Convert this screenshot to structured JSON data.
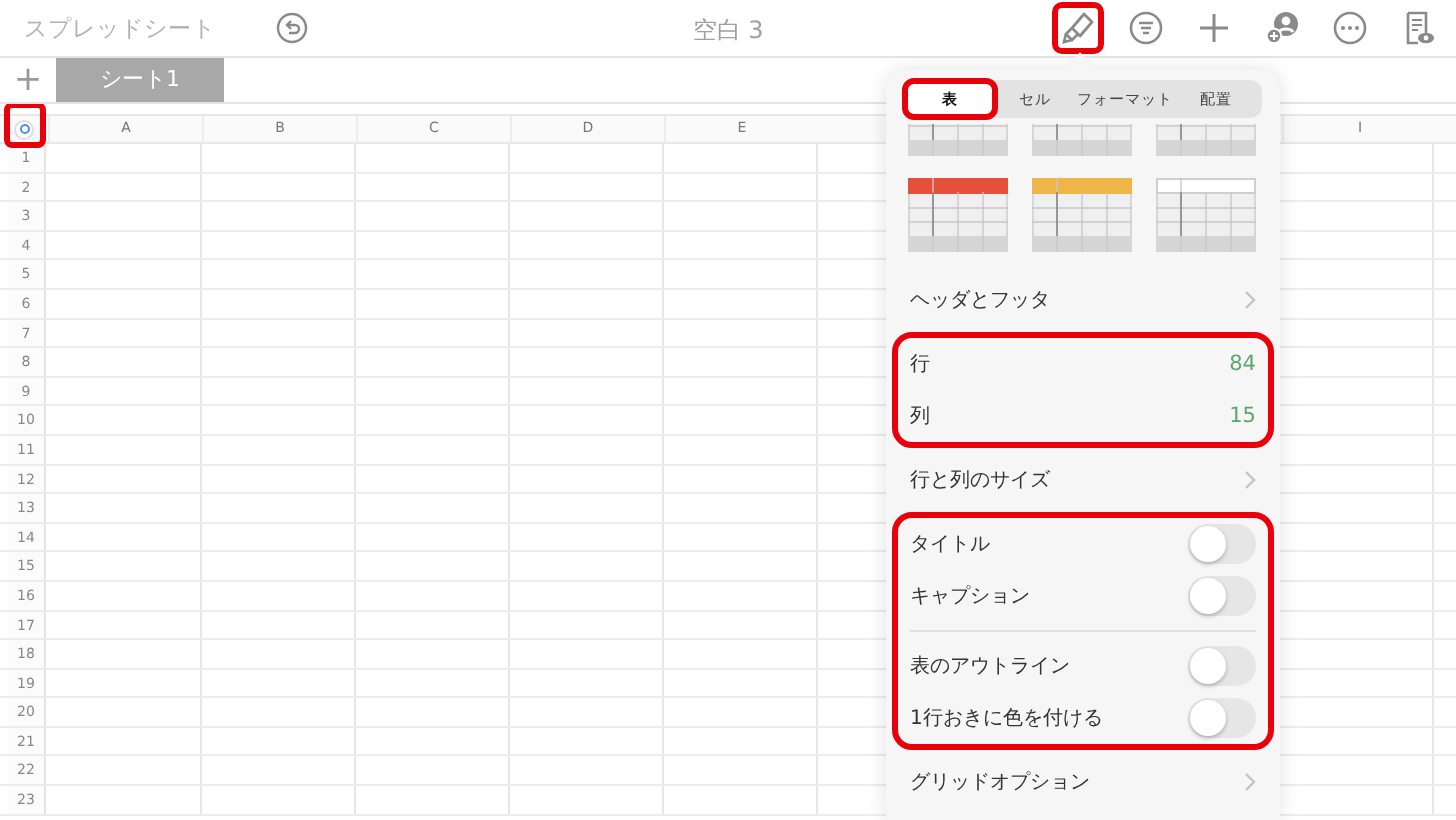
{
  "toolbar": {
    "back_label": "スプレッドシート",
    "title": "空白 3",
    "tools": [
      {
        "kind": "brush",
        "highlighted": true
      },
      {
        "kind": "list",
        "highlighted": false
      },
      {
        "kind": "plus",
        "highlighted": false
      },
      {
        "kind": "person",
        "highlighted": false
      },
      {
        "kind": "more",
        "highlighted": false
      },
      {
        "kind": "doc",
        "highlighted": false
      }
    ]
  },
  "sheet_tabs": {
    "add_label": "+",
    "tabs": [
      {
        "label": "シート1",
        "selected": true
      }
    ]
  },
  "grid": {
    "corner_highlighted": true,
    "columns": [
      {
        "label": "A"
      },
      {
        "label": "B"
      },
      {
        "label": "C"
      },
      {
        "label": "D"
      },
      {
        "label": "E"
      },
      {
        "label": "I"
      }
    ],
    "rows": [
      "1",
      "2",
      "3",
      "4",
      "5",
      "6",
      "7",
      "8",
      "9",
      "10",
      "11",
      "12",
      "13",
      "14",
      "15",
      "16",
      "17",
      "18",
      "19",
      "20",
      "21",
      "22",
      "23"
    ]
  },
  "popover": {
    "tabs": [
      {
        "label": "表",
        "selected": true,
        "highlighted": true
      },
      {
        "label": "セル",
        "selected": false,
        "highlighted": false
      },
      {
        "label": "フォーマット",
        "selected": false,
        "highlighted": false
      },
      {
        "label": "配置",
        "selected": false,
        "highlighted": false
      }
    ],
    "styles": [
      {
        "color": "#c9c9c9",
        "clipped": true
      },
      {
        "color": "#d0d0d0",
        "clipped": true
      },
      {
        "color": "#d0d0d0",
        "clipped": true
      },
      {
        "color": "#e5503b",
        "clipped": false
      },
      {
        "color": "#efb548",
        "clipped": false
      },
      {
        "color": "#ffffff",
        "clipped": false
      }
    ],
    "sections": [
      {
        "highlighted": false,
        "rows": [
          {
            "kind": "link",
            "label": "ヘッダとフッタ"
          }
        ]
      },
      {
        "highlighted": true,
        "rows": [
          {
            "kind": "value",
            "label": "行",
            "value": "84"
          },
          {
            "kind": "value",
            "label": "列",
            "value": "15"
          }
        ]
      },
      {
        "highlighted": false,
        "rows": [
          {
            "kind": "link",
            "label": "行と列のサイズ"
          }
        ]
      },
      {
        "highlighted": true,
        "rows": [
          {
            "kind": "toggle",
            "label": "タイトル",
            "on": false
          },
          {
            "kind": "toggle",
            "label": "キャプション",
            "on": false
          },
          {
            "kind": "divider"
          },
          {
            "kind": "toggle",
            "label": "表のアウトライン",
            "on": false
          },
          {
            "kind": "toggle",
            "label": "1行おきに色を付ける",
            "on": false
          }
        ]
      },
      {
        "highlighted": false,
        "rows": [
          {
            "kind": "link",
            "label": "グリッドオプション"
          }
        ]
      }
    ]
  }
}
